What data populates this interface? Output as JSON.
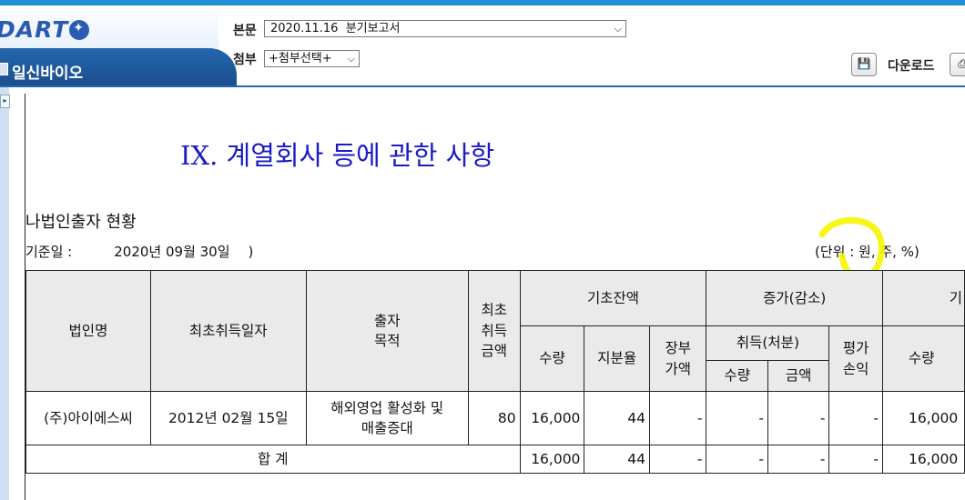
{
  "header": {
    "logo_text": "DART",
    "company_name": "일신바이오",
    "bonmun_label": "본문",
    "bonmun_value": "2020.11.16  분기보고서",
    "cheombu_label": "첨부",
    "cheombu_value": "+첨부선택+",
    "download_label": "다운로드"
  },
  "document": {
    "title": "IX. 계열회사 등에 관한 사항",
    "section": "나법인출자 현황",
    "base_date_label": "기준일 :",
    "base_date_value": "2020년 09월 30일",
    "base_date_close": ")",
    "unit": "(단위 : 원, 주, %)"
  },
  "table": {
    "headers": {
      "company": "법인명",
      "first_date": "최초취득일자",
      "purpose": "출자\n목적",
      "initial_amount": "최초\n취득\n금액",
      "opening": "기초잔액",
      "change": "증가(감소)",
      "closing": "기",
      "qty": "수량",
      "share": "지분율",
      "book_value": "장부\n가액",
      "acquire": "취득(처분)",
      "eval": "평가\n손익",
      "acq_qty": "수량",
      "acq_amount": "금액",
      "end_qty": "수량"
    },
    "rows": [
      {
        "company": "(주)아이에스씨",
        "first_date": "2012년 02월 15일",
        "purpose": "해외영업 활성화 및\n매출증대",
        "initial_amount": "80",
        "qty": "16,000",
        "share": "44",
        "book_value": "-",
        "acq_qty": "-",
        "acq_amount": "-",
        "eval": "-",
        "end_qty": "16,000"
      }
    ],
    "total": {
      "label": "합 계",
      "qty": "16,000",
      "share": "44",
      "book_value": "-",
      "acq_qty": "-",
      "acq_amount": "-",
      "eval": "-",
      "end_qty": "16,000"
    }
  },
  "colors": {
    "title": "#1a1ac8",
    "header_blue": "#2466ad",
    "highlight": "#f5f500"
  }
}
